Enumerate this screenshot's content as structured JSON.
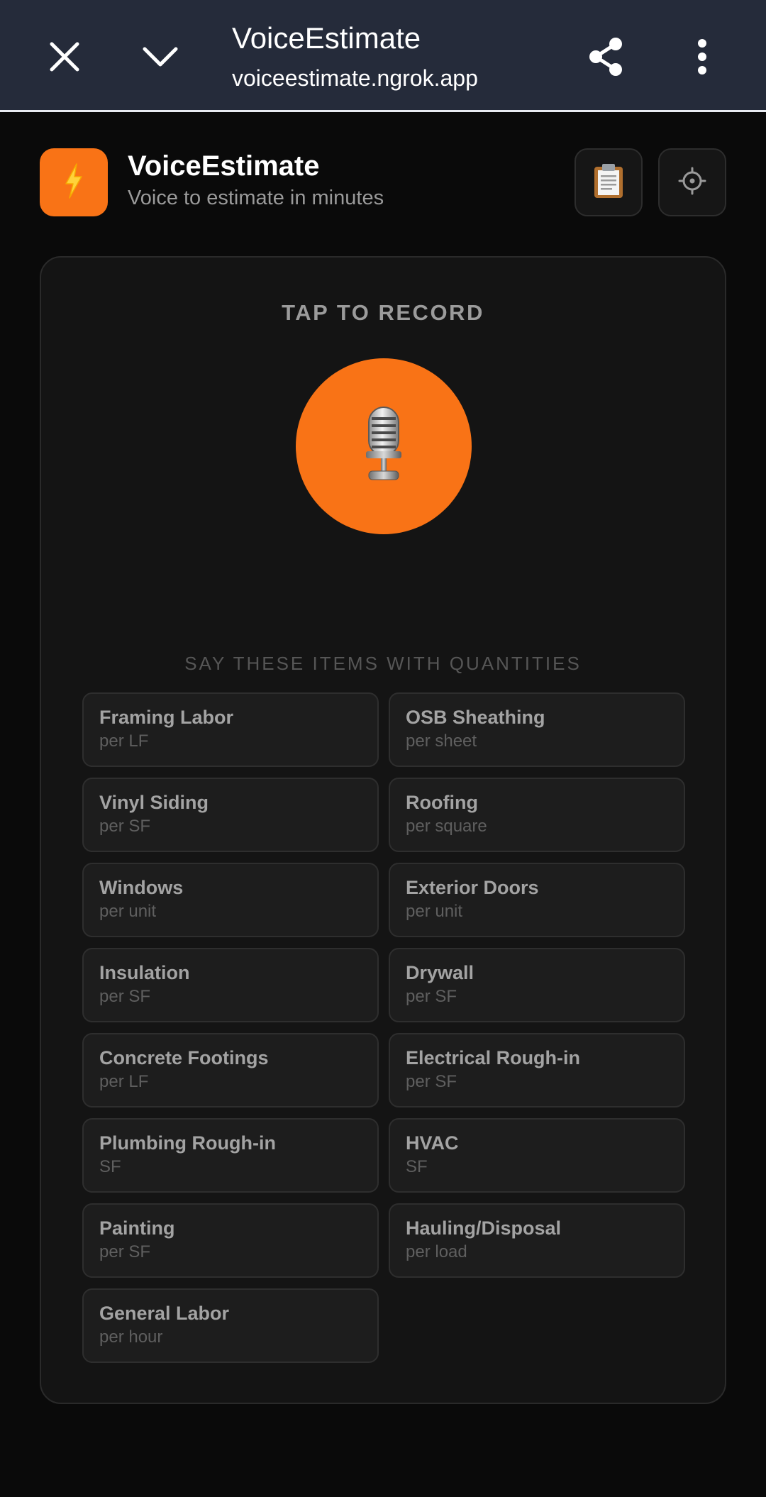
{
  "browser": {
    "title": "VoiceEstimate",
    "url": "voiceestimate.ngrok.app",
    "icons": [
      "close-icon",
      "chevron-down-icon",
      "share-icon",
      "more-vert-icon"
    ]
  },
  "app": {
    "name": "VoiceEstimate",
    "tagline": "Voice to estimate in minutes",
    "logo_icon": "lightning-bolt-icon",
    "header_buttons": [
      "clipboard-icon",
      "settings-icon"
    ],
    "accent_color": "#f97316"
  },
  "recorder": {
    "heading": "TAP TO RECORD",
    "mic_icon": "microphone-icon"
  },
  "items_section": {
    "heading": "SAY THESE ITEMS WITH QUANTITIES",
    "items": [
      {
        "name": "Framing Labor",
        "unit": "per LF"
      },
      {
        "name": "OSB Sheathing",
        "unit": "per sheet"
      },
      {
        "name": "Vinyl Siding",
        "unit": "per SF"
      },
      {
        "name": "Roofing",
        "unit": "per square"
      },
      {
        "name": "Windows",
        "unit": "per unit"
      },
      {
        "name": "Exterior Doors",
        "unit": "per unit"
      },
      {
        "name": "Insulation",
        "unit": "per SF"
      },
      {
        "name": "Drywall",
        "unit": "per SF"
      },
      {
        "name": "Concrete Footings",
        "unit": "per LF"
      },
      {
        "name": "Electrical Rough-in",
        "unit": "per SF"
      },
      {
        "name": "Plumbing Rough-in",
        "unit": "SF"
      },
      {
        "name": "HVAC",
        "unit": "SF"
      },
      {
        "name": "Painting",
        "unit": "per SF"
      },
      {
        "name": "Hauling/Disposal",
        "unit": "per load"
      },
      {
        "name": "General Labor",
        "unit": "per hour"
      }
    ]
  }
}
